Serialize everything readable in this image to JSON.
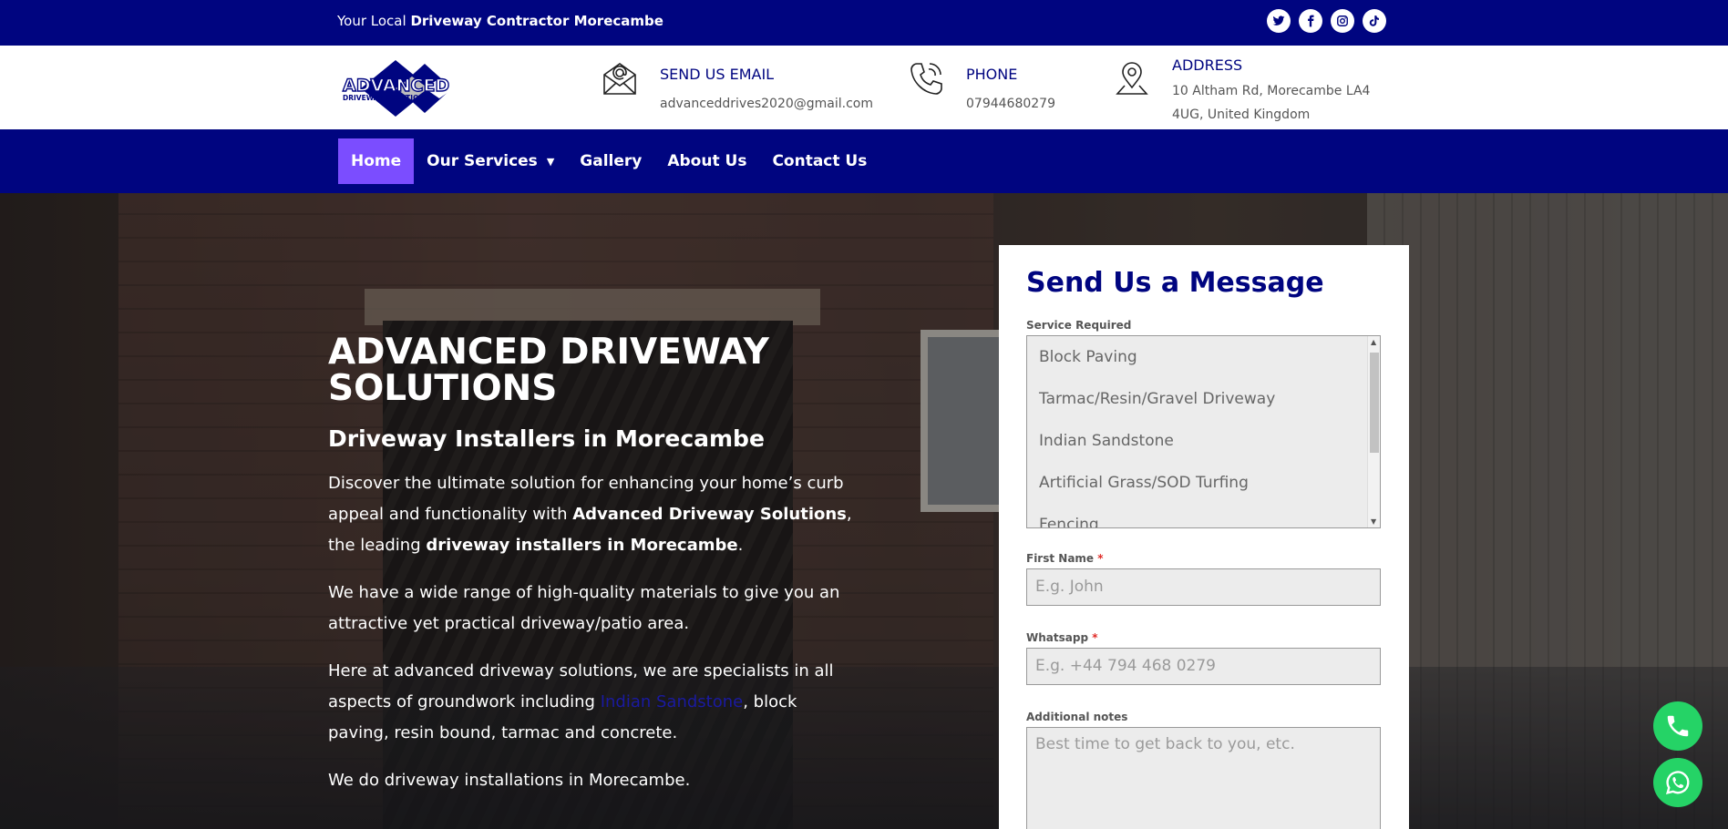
{
  "topbar": {
    "tagline_prefix": "Your Local ",
    "tagline_bold": "Driveway Contractor Morecambe",
    "socials": [
      "twitter-icon",
      "facebook-icon",
      "instagram-icon",
      "tiktok-icon"
    ]
  },
  "header": {
    "logo_text": "ADVANCED",
    "logo_subtext": "DRIVEWAY SOLUTIONS",
    "email": {
      "title": "SEND US EMAIL",
      "value": "advanceddrives2020@gmail.com"
    },
    "phone": {
      "title": "PHONE",
      "value": "07944680279"
    },
    "address": {
      "title": "ADDRESS",
      "value": "10 Altham Rd, Morecambe LA4 4UG, United Kingdom"
    }
  },
  "nav": {
    "items": [
      "Home",
      "Our Services",
      "Gallery",
      "About Us",
      "Contact Us"
    ],
    "active": "Home"
  },
  "hero": {
    "title": "ADVANCED DRIVEWAY SOLUTIONS",
    "subtitle": "Driveway Installers in Morecambe",
    "p1_a": "Discover the ultimate solution for enhancing your home’s curb appeal and functionality with ",
    "p1_b": "Advanced Driveway Solutions",
    "p1_c": ", the leading ",
    "p1_d": "driveway installers in Morecambe",
    "p1_e": ".",
    "p2": "We have a wide range of high-quality materials to give you an attractive yet practical driveway/patio area.",
    "p3_a": "Here at advanced driveway solutions, we are specialists in  all aspects of groundwork including ",
    "p3_link": "Indian Sandstone",
    "p3_b": ", block paving, resin bound, tarmac and concrete.",
    "p4": "We do driveway installations in Morecambe."
  },
  "form": {
    "title": "Send Us a Message",
    "service_label": "Service Required",
    "service_options": [
      "Block Paving",
      "Tarmac/Resin/Gravel Driveway",
      "Indian Sandstone",
      "Artificial Grass/SOD Turfing",
      "Fencing"
    ],
    "first_name_label": "First Name",
    "first_name_placeholder": "E.g. John",
    "whatsapp_label": "Whatsapp",
    "whatsapp_placeholder": "E.g. +44 794 468 0279",
    "notes_label": "Additional notes",
    "notes_placeholder": "Best time to get back to you, etc.",
    "required_mark": "*"
  },
  "colors": {
    "brand_navy": "#000580",
    "nav_active": "#7b4dff",
    "fab_green": "#25d366"
  }
}
